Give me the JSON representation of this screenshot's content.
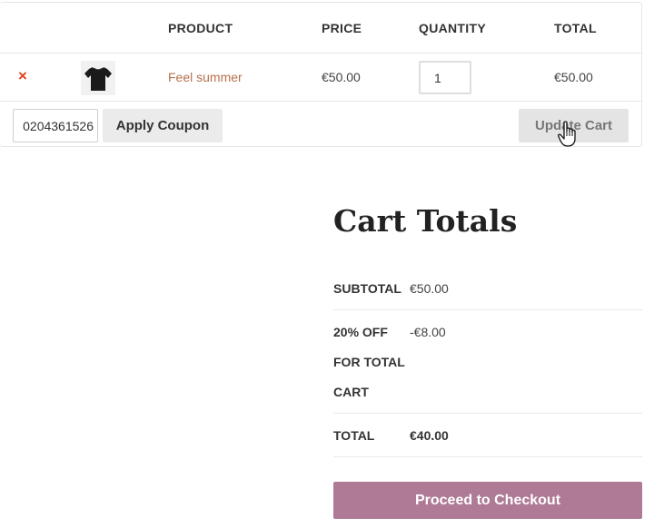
{
  "cart": {
    "headers": {
      "product": "PRODUCT",
      "price": "PRICE",
      "quantity": "QUANTITY",
      "total": "TOTAL"
    },
    "items": [
      {
        "remove_symbol": "×",
        "thumbnail_icon": "tshirt-icon",
        "name": "Feel summer",
        "price": "€50.00",
        "quantity": "1",
        "total": "€50.00"
      }
    ],
    "coupon": {
      "value": "0204361526",
      "apply_label": "Apply Coupon"
    },
    "update_label": "Update Cart"
  },
  "totals": {
    "title": "Cart Totals",
    "subtotal_label": "SUBTOTAL",
    "subtotal_value": "€50.00",
    "discount_label": "20% OFF FOR TOTAL CART",
    "discount_value": "-€8.00",
    "total_label": "TOTAL",
    "total_value": "€40.00",
    "checkout_label": "Proceed to Checkout"
  },
  "colors": {
    "remove": "#e2401c",
    "product_link": "#b5704c",
    "checkout_button": "#ae7a96"
  }
}
